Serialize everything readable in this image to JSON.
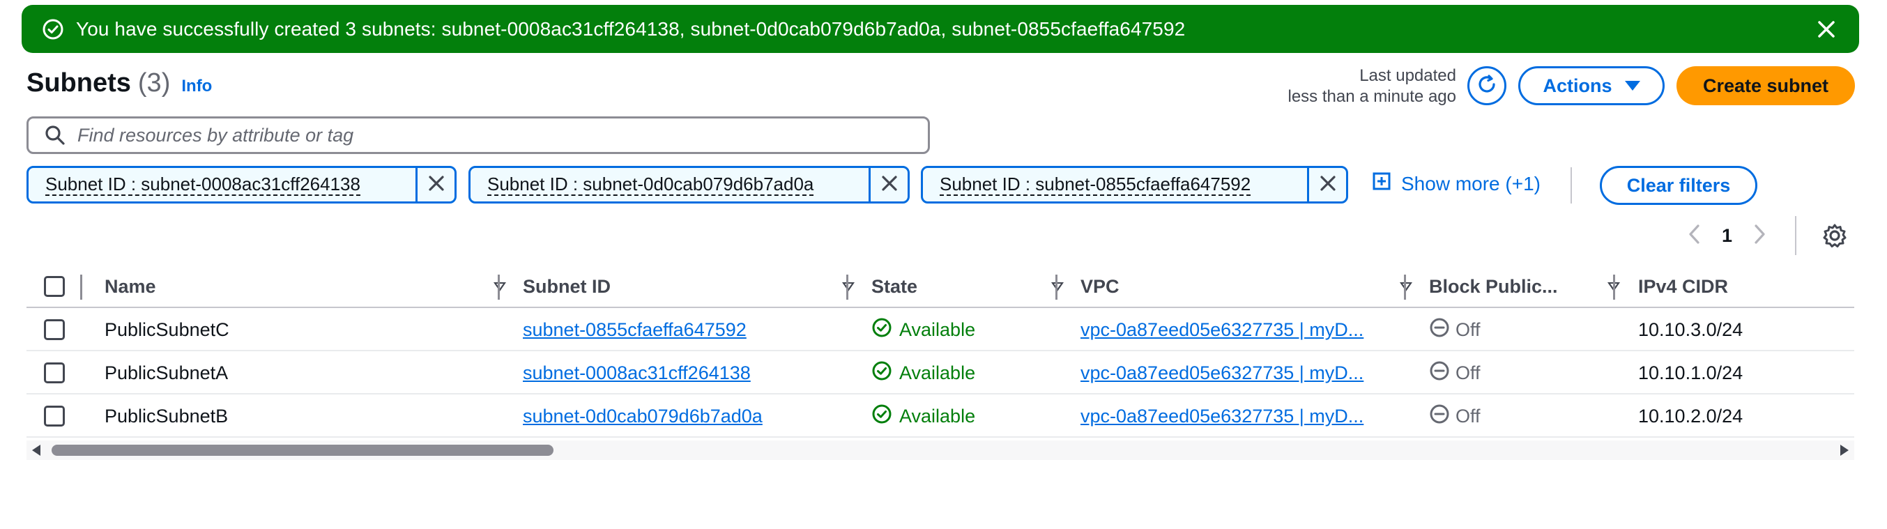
{
  "flash": {
    "message": "You have successfully created 3 subnets: subnet-0008ac31cff264138, subnet-0d0cab079d6b7ad0a, subnet-0855cfaeffa647592",
    "color": "#037f0c"
  },
  "header": {
    "title": "Subnets",
    "count": "(3)",
    "info_label": "Info",
    "last_updated_line1": "Last updated",
    "last_updated_line2": "less than a minute ago",
    "actions_label": "Actions",
    "create_label": "Create subnet"
  },
  "search": {
    "placeholder": "Find resources by attribute or tag"
  },
  "filters": {
    "tokens": [
      "Subnet ID : subnet-0008ac31cff264138",
      "Subnet ID : subnet-0d0cab079d6b7ad0a",
      "Subnet ID : subnet-0855cfaeffa647592"
    ],
    "show_more_label": "Show more (+1)",
    "clear_label": "Clear filters"
  },
  "pagination": {
    "current_page": "1"
  },
  "table": {
    "columns": [
      "Name",
      "Subnet ID",
      "State",
      "VPC",
      "Block Public...",
      "IPv4 CIDR"
    ],
    "rows": [
      {
        "name": "PublicSubnetC",
        "subnet_id": "subnet-0855cfaeffa647592",
        "state": "Available",
        "vpc": "vpc-0a87eed05e6327735 | myD...",
        "block_public": "Off",
        "ipv4_cidr": "10.10.3.0/24"
      },
      {
        "name": "PublicSubnetA",
        "subnet_id": "subnet-0008ac31cff264138",
        "state": "Available",
        "vpc": "vpc-0a87eed05e6327735 | myD...",
        "block_public": "Off",
        "ipv4_cidr": "10.10.1.0/24"
      },
      {
        "name": "PublicSubnetB",
        "subnet_id": "subnet-0d0cab079d6b7ad0a",
        "state": "Available",
        "vpc": "vpc-0a87eed05e6327735 | myD...",
        "block_public": "Off",
        "ipv4_cidr": "10.10.2.0/24"
      }
    ]
  },
  "colors": {
    "primary_link": "#006ce0",
    "success": "#037f0c",
    "create_button": "#ff9900"
  }
}
